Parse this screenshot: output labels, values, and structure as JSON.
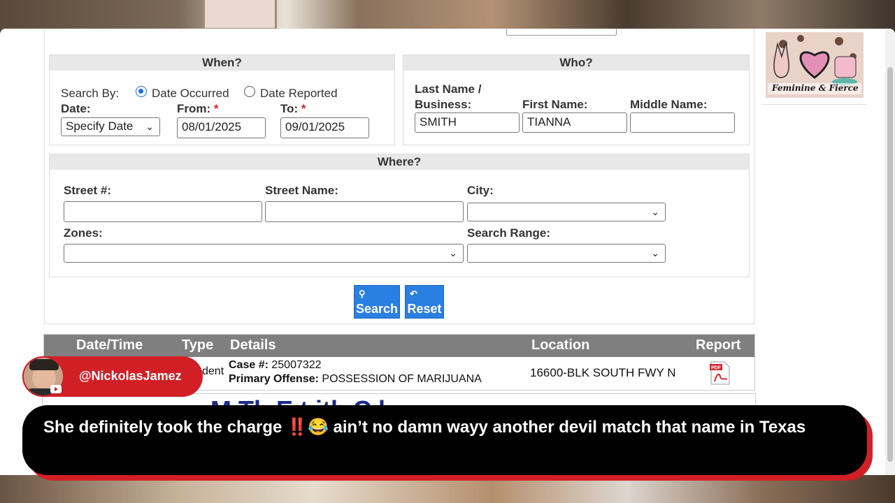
{
  "when": {
    "heading": "When?",
    "search_by_label": "Search By:",
    "radio_occurred": "Date Occurred",
    "radio_reported": "Date Reported",
    "date_label": "Date:",
    "from_label": "From:",
    "to_label": "To:",
    "required_mark": "*",
    "date_select_value": "Specify Date",
    "from_value": "08/01/2025",
    "to_value": "09/01/2025"
  },
  "who": {
    "heading": "Who?",
    "last_name_label_1": "Last Name /",
    "last_name_label_2": "Business:",
    "first_name_label": "First Name:",
    "middle_name_label": "Middle Name:",
    "last_name_value": "SMITH",
    "first_name_value": "TIANNA",
    "middle_name_value": ""
  },
  "where": {
    "heading": "Where?",
    "street_num_label": "Street #:",
    "street_name_label": "Street Name:",
    "city_label": "City:",
    "zones_label": "Zones:",
    "search_range_label": "Search Range:"
  },
  "buttons": {
    "search_label": "Search",
    "reset_label": "Reset"
  },
  "results": {
    "columns": [
      "Date/Time",
      "Type",
      "Details",
      "Location",
      "Report"
    ],
    "row": {
      "type_fragment": "dent",
      "case_label": "Case #:",
      "case_value": "25007322",
      "offense_label": "Primary Offense:",
      "offense_value": "POSSESSION OF MARIJUANA",
      "location": "16600-BLK SOUTH FWY N"
    }
  },
  "next_panel_text": "M    Th    E    t    ith  C    l",
  "overlay": {
    "handle": "@NickolasJamez",
    "caption": "She definitely took the charge ‼️😂 ain’t no damn wayy another devil match that name in Texas"
  },
  "logo_text": "Feminine & Fierce",
  "colors": {
    "button_blue": "#2a7fe3",
    "table_header": "#7f7f7f",
    "badge_red": "#d21f26"
  }
}
